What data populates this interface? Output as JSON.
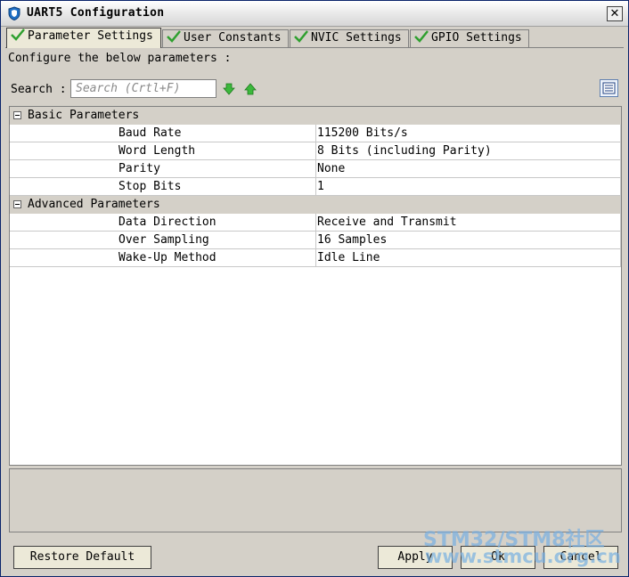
{
  "window": {
    "title": "UART5 Configuration",
    "close_symbol": "✕"
  },
  "tabs": [
    {
      "label": "Parameter Settings",
      "active": true,
      "icon": "check-icon"
    },
    {
      "label": "User Constants",
      "active": false,
      "icon": "check-icon"
    },
    {
      "label": "NVIC Settings",
      "active": false,
      "icon": "check-icon"
    },
    {
      "label": "GPIO Settings",
      "active": false,
      "icon": "check-icon"
    }
  ],
  "subtitle": "Configure the below parameters :",
  "search": {
    "label": "Search :",
    "placeholder": "Search (Crtl+F)"
  },
  "groups": [
    {
      "label": "Basic Parameters",
      "params": [
        {
          "name": "Baud Rate",
          "value": "115200 Bits/s"
        },
        {
          "name": "Word Length",
          "value": "8 Bits (including Parity)"
        },
        {
          "name": "Parity",
          "value": "None"
        },
        {
          "name": "Stop Bits",
          "value": "1"
        }
      ]
    },
    {
      "label": "Advanced Parameters",
      "params": [
        {
          "name": "Data Direction",
          "value": "Receive and Transmit"
        },
        {
          "name": "Over Sampling",
          "value": "16 Samples"
        },
        {
          "name": "Wake-Up Method",
          "value": "Idle Line"
        }
      ]
    }
  ],
  "buttons": {
    "restore": "Restore Default",
    "apply": "Apply",
    "ok": "Ok",
    "cancel": "Cancel"
  },
  "watermark": {
    "line1": "STM32/STM8社区",
    "line2": "www.stmcu.org.cn"
  },
  "colors": {
    "check_green": "#2fa02f",
    "arrow_green": "#3cb83c",
    "title_icon_blue": "#1f6fc4"
  }
}
